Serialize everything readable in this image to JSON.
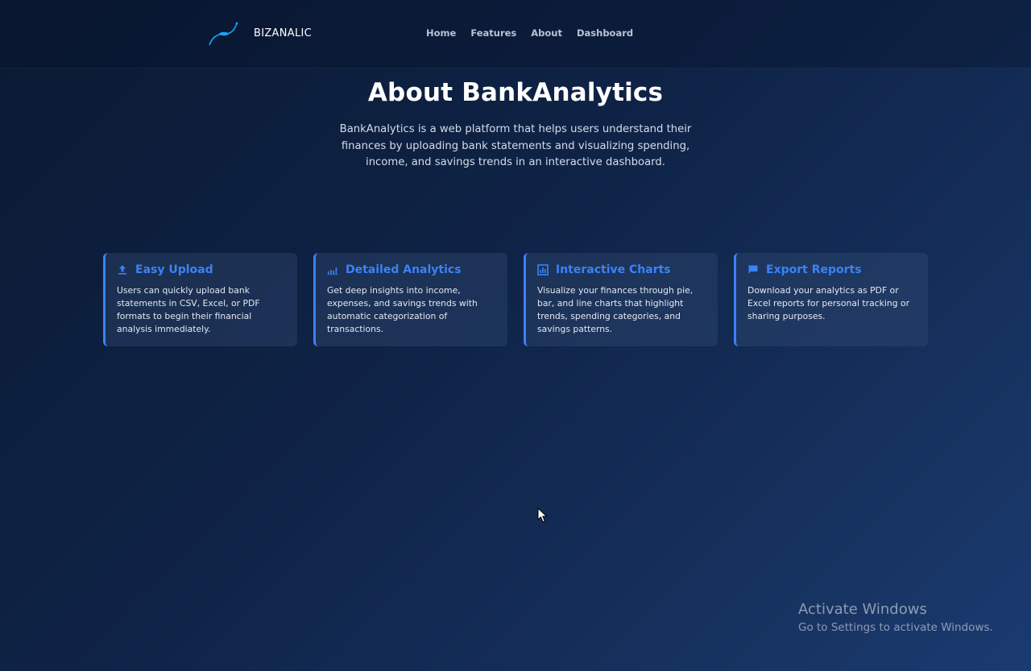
{
  "header": {
    "brand_name": "BIZANALIC",
    "nav": [
      {
        "label": "Home"
      },
      {
        "label": "Features"
      },
      {
        "label": "About"
      },
      {
        "label": "Dashboard"
      }
    ]
  },
  "hero": {
    "title": "About BankAnalytics",
    "description": "BankAnalytics is a web platform that helps users understand their finances by uploading bank statements and visualizing spending, income, and savings trends in an interactive dashboard."
  },
  "features": [
    {
      "icon": "upload-icon",
      "title": "Easy Upload",
      "text": "Users can quickly upload bank statements in CSV, Excel, or PDF formats to begin their financial analysis immediately."
    },
    {
      "icon": "signal-bars-icon",
      "title": "Detailed Analytics",
      "text": "Get deep insights into income, expenses, and savings trends with automatic categorization of transactions."
    },
    {
      "icon": "bar-chart-icon",
      "title": "Interactive Charts",
      "text": "Visualize your finances through pie, bar, and line charts that highlight trends, spending categories, and savings patterns."
    },
    {
      "icon": "flag-icon",
      "title": "Export Reports",
      "text": "Download your analytics as PDF or Excel reports for personal tracking or sharing purposes."
    }
  ],
  "watermark": {
    "title": "Activate Windows",
    "subtitle": "Go to Settings to activate Windows."
  },
  "colors": {
    "accent": "#3b82f6",
    "background": "#0f2347"
  }
}
